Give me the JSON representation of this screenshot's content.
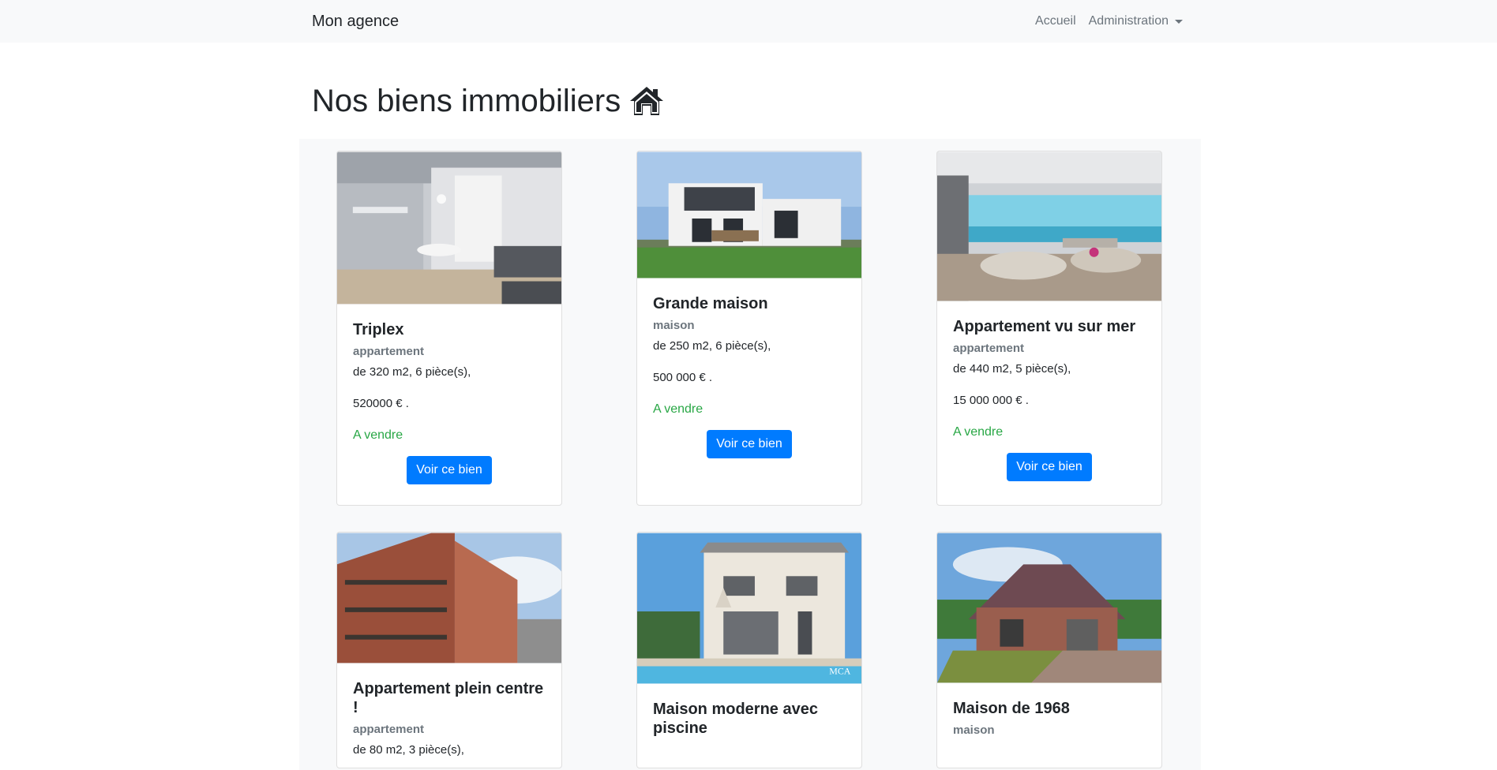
{
  "navbar": {
    "brand": "Mon agence",
    "links": [
      {
        "label": "Accueil"
      },
      {
        "label": "Administration"
      }
    ]
  },
  "page": {
    "title": "Nos biens immobiliers",
    "title_icon": "home-icon"
  },
  "colors": {
    "primary": "#007bff",
    "success": "#28a745",
    "muted": "#6c757d",
    "navbar_bg": "#f8f9fa"
  },
  "properties": [
    {
      "title": "Triplex",
      "type": "appartement",
      "details": "de 320 m2, 6 pièce(s),",
      "price": "520000 € .",
      "status": "A vendre",
      "button": "Voir ce bien",
      "image": "modern-apartment-interior"
    },
    {
      "title": "Grande maison",
      "type": "maison",
      "details": "de 250 m2, 6 pièce(s),",
      "price": "500 000 € .",
      "status": "A vendre",
      "button": "Voir ce bien",
      "image": "modern-house-exterior"
    },
    {
      "title": "Appartement vu sur mer",
      "type": "appartement",
      "details": "de 440 m2, 5 pièce(s),",
      "price": "15 000 000 € .",
      "status": "A vendre",
      "button": "Voir ce bien",
      "image": "sea-view-living-room"
    },
    {
      "title": "Appartement plein centre !",
      "type": "appartement",
      "details": "de 80 m2, 3 pièce(s),",
      "image": "brick-apartment-building"
    },
    {
      "title": "Maison moderne avec piscine",
      "image": "house-with-pool",
      "watermark": "MCA"
    },
    {
      "title": "Maison de 1968",
      "type": "maison",
      "image": "brick-house"
    }
  ]
}
